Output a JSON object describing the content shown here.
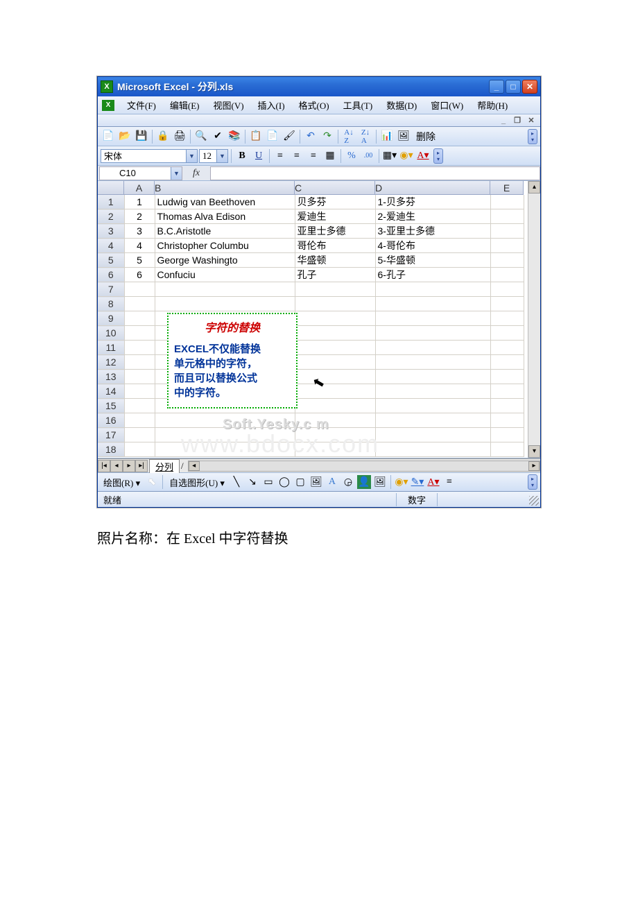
{
  "title": "Microsoft Excel - 分列.xls",
  "menus": {
    "file": "文件(F)",
    "edit": "编辑(E)",
    "view": "视图(V)",
    "insert": "插入(I)",
    "format": "格式(O)",
    "tools": "工具(T)",
    "data": "数据(D)",
    "window": "窗口(W)",
    "help": "帮助(H)"
  },
  "font_name": "宋体",
  "font_size": "12",
  "toolbar_text": {
    "delete": "删除"
  },
  "name_box": "C10",
  "fx_label": "fx",
  "columns": [
    "A",
    "B",
    "C",
    "D",
    "E"
  ],
  "rows": [
    {
      "n": "1",
      "A": "1",
      "B": "Ludwig van Beethoven",
      "C": "贝多芬",
      "D": "1-贝多芬"
    },
    {
      "n": "2",
      "A": "2",
      "B": "Thomas Alva Edison",
      "C": "爱迪生",
      "D": "2-爱迪生"
    },
    {
      "n": "3",
      "A": "3",
      "B": "B.C.Aristotle",
      "C": "亚里士多德",
      "D": "3-亚里士多德"
    },
    {
      "n": "4",
      "A": "4",
      "B": "Christopher Columbu",
      "C": "哥伦布",
      "D": "4-哥伦布"
    },
    {
      "n": "5",
      "A": "5",
      "B": "George Washingto",
      "C": "华盛顿",
      "D": "5-华盛顿"
    },
    {
      "n": "6",
      "A": "6",
      "B": "Confuciu",
      "C": "孔子",
      "D": "6-孔子"
    },
    {
      "n": "7",
      "A": "",
      "B": "",
      "C": "",
      "D": ""
    },
    {
      "n": "8",
      "A": "",
      "B": "",
      "C": "",
      "D": ""
    },
    {
      "n": "9",
      "A": "",
      "B": "",
      "C": "",
      "D": ""
    },
    {
      "n": "10",
      "A": "",
      "B": "",
      "C": "",
      "D": ""
    },
    {
      "n": "11",
      "A": "",
      "B": "",
      "C": "",
      "D": ""
    },
    {
      "n": "12",
      "A": "",
      "B": "",
      "C": "",
      "D": ""
    },
    {
      "n": "13",
      "A": "",
      "B": "",
      "C": "",
      "D": ""
    },
    {
      "n": "14",
      "A": "",
      "B": "",
      "C": "",
      "D": ""
    },
    {
      "n": "15",
      "A": "",
      "B": "",
      "C": "",
      "D": ""
    },
    {
      "n": "16",
      "A": "",
      "B": "",
      "C": "",
      "D": ""
    },
    {
      "n": "17",
      "A": "",
      "B": "",
      "C": "",
      "D": ""
    },
    {
      "n": "18",
      "A": "",
      "B": "",
      "C": "",
      "D": ""
    }
  ],
  "callout": {
    "title": "字符的替换",
    "line1": "EXCEL不仅能替换",
    "line2": "单元格中的字符，",
    "line3": "而且可以替换公式",
    "line4": "中的字符。"
  },
  "watermark1": "Soft.Yesky.c   m",
  "watermark2": "www.bdocx.com",
  "sheet_tab": "分列",
  "draw_bar": {
    "draw": "绘图(R)",
    "autoshapes": "自选图形(U)"
  },
  "status": {
    "ready": "就绪",
    "mode": "数字"
  },
  "caption": "照片名称：在 Excel 中字符替换"
}
